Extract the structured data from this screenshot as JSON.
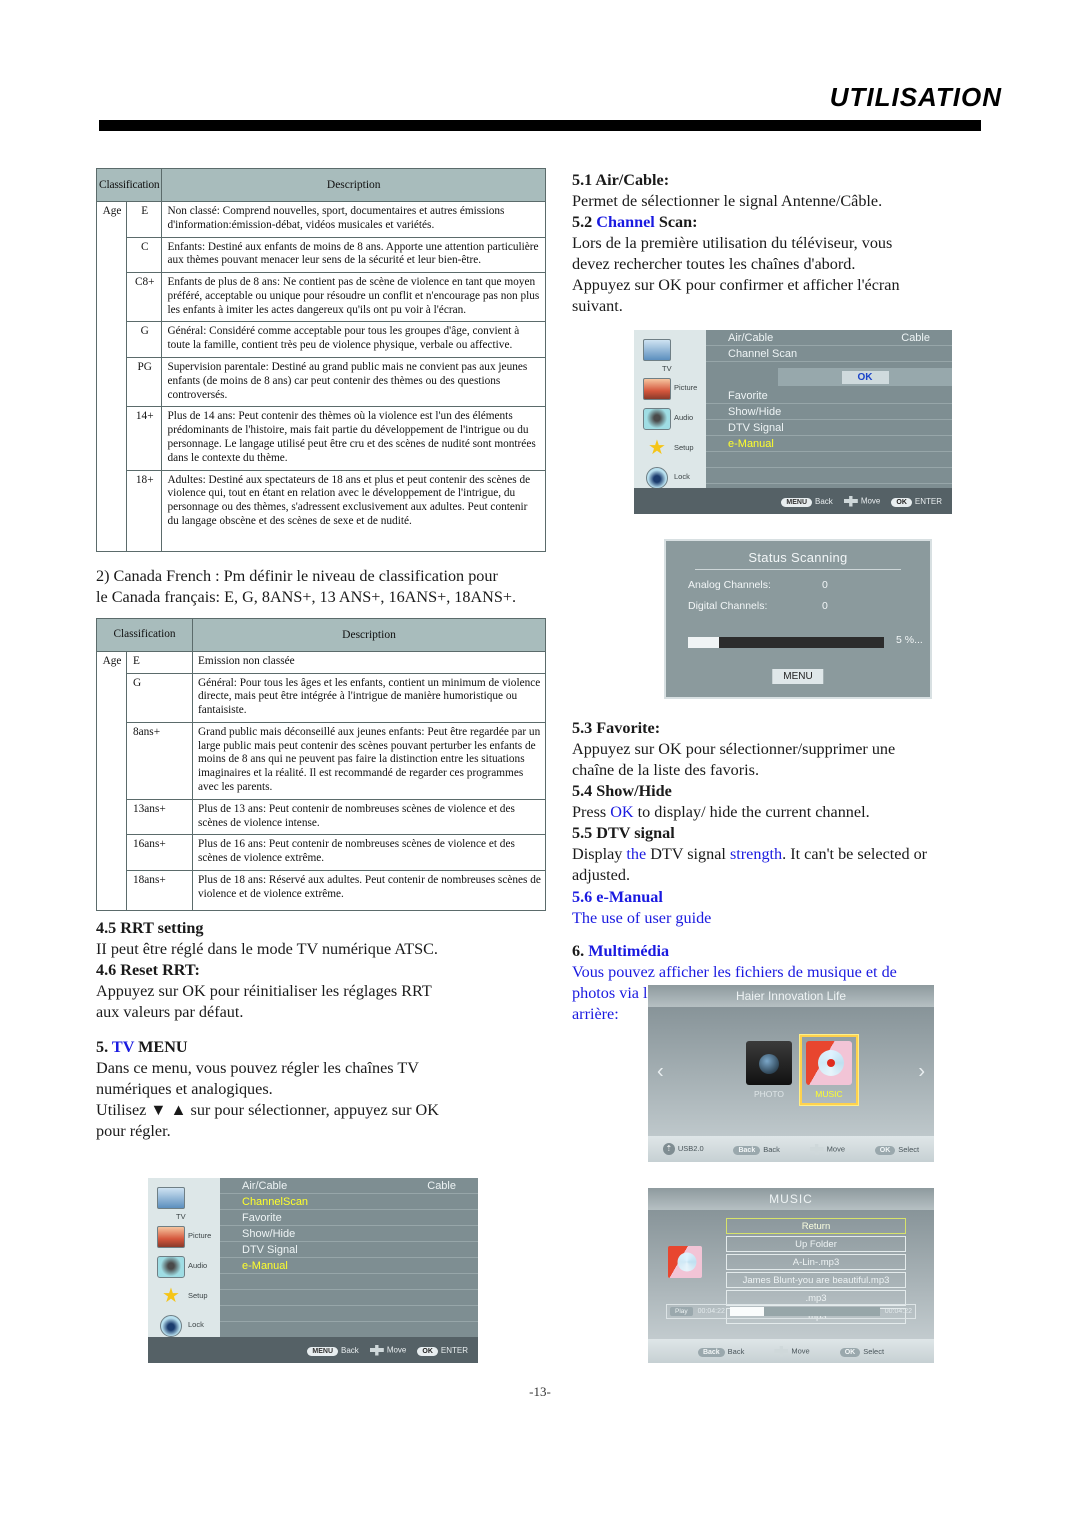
{
  "header": {
    "title": "UTILISATION"
  },
  "page_number": "-13-",
  "table1": {
    "col_classification": "Classification",
    "col_description": "Description",
    "age_label": "Age",
    "rows": [
      {
        "code": "E",
        "desc": "Non classé: Comprend nouvelles, sport, documentaires et autres émissions d'information:émission-débat, vidéos musicales et variétés."
      },
      {
        "code": "C",
        "desc": "Enfants: Destiné aux enfants de moins de 8 ans. Apporte une attention particulière aux thèmes pouvant menacer leur sens de la sécurité et leur bien-être."
      },
      {
        "code": "C8+",
        "desc": "Enfants de plus de 8 ans: Ne contient pas de scène de violence en tant que moyen préféré, acceptable ou unique pour résoudre un conflit et n'encourage pas non plus les enfants à imiter les actes dangereux qu'ils ont pu voir à l'écran."
      },
      {
        "code": "G",
        "desc": "Général: Considéré comme acceptable pour tous les groupes d'âge, convient à toute la famille, contient très peu de violence physique, verbale ou affective."
      },
      {
        "code": "PG",
        "desc": "Supervision parentale: Destiné au grand public mais ne convient pas aux jeunes enfants (de moins de 8 ans) car peut contenir des thèmes ou des questions controversés."
      },
      {
        "code": "14+",
        "desc": "Plus de 14 ans: Peut contenir des thèmes où la violence est l'un des éléments prédominants de l'histoire, mais fait partie du développement de l'intrigue ou du personnage. Le langage utilisé peut être cru et des scènes de nudité sont montrées dans le contexte du thème."
      },
      {
        "code": "18+",
        "desc": "Adultes: Destiné aux spectateurs de 18 ans et plus et peut contenir des scènes de violence qui, tout en étant en relation avec le développement de l'intrigue, du personnage ou des thèmes, s'adressent exclusivement aux adultes. Peut contenir du langage obscène et des scènes de sexe et de nudité."
      }
    ]
  },
  "mid_note": {
    "line1": "2) Canada French : Pm définir le niveau de classification pour",
    "line2": "le Canada français: E, G, 8ANS+, 13 ANS+, 16ANS+, 18ANS+."
  },
  "table2": {
    "col_classification": "Classification",
    "col_description": "Description",
    "age_label": "Age",
    "rows": [
      {
        "code": "E",
        "desc": "Emission non classée"
      },
      {
        "code": "G",
        "desc": "Général: Pour tous les âges et les enfants, contient un minimum de violence directe, mais peut être intégrée à l'intrigue de manière humoristique ou fantaisiste."
      },
      {
        "code": "8ans+",
        "desc": "Grand public mais déconseillé aux jeunes enfants: Peut être regardée par un large public mais peut contenir des scènes pouvant perturber les enfants de moins de 8 ans qui ne peuvent pas faire la distinction entre les situations imaginaires et la réalité. Il est recommandé de regarder ces programmes avec les parents."
      },
      {
        "code": "13ans+",
        "desc": "Plus de 13 ans: Peut contenir de nombreuses scènes de violence et des scènes de violence intense."
      },
      {
        "code": "16ans+",
        "desc": "Plus de 16 ans: Peut contenir de nombreuses scènes de violence et des scènes de violence extrême."
      },
      {
        "code": "18ans+",
        "desc": "Plus de 18 ans: Réservé aux adultes. Peut contenir de nombreuses scènes de violence et de violence extrême."
      }
    ]
  },
  "left_sections": {
    "s45_title": "4.5 RRT setting",
    "s45_body": "II peut être réglé dans le mode TV numérique ATSC.",
    "s46_title": "4.6 Reset RRT:",
    "s46_body_l1": "Appuyez sur OK pour réinitialiser les réglages RRT",
    "s46_body_l2": "aux valeurs par défaut.",
    "s5_num": "5.",
    "s5_blue": "TV",
    "s5_rest": "MENU",
    "s5_body_l1": "Dans ce menu, vous pouvez régler les chaînes TV",
    "s5_body_l2": "numériques et analogiques.",
    "s5_body_l3": "Utilisez ▼ ▲ sur pour sélectionner, appuyez sur OK",
    "s5_body_l4": "pour régler."
  },
  "right_sections": {
    "s51_title": "5.1 Air/Cable:",
    "s51_body": "Permet de sélectionner le signal Antenne/Câble.",
    "s52_num": "5.2",
    "s52_blue": "Channel",
    "s52_rest": "Scan:",
    "s52_body_l1": "Lors de la première utilisation du téléviseur, vous",
    "s52_body_l2": "devez rechercher toutes les chaînes d'abord.",
    "s52_body_l3": "Appuyez sur OK pour confirmer et afficher l'écran",
    "s52_body_l4": "suivant.",
    "s53_title": "5.3 Favorite:",
    "s53_body_l1": "Appuyez sur OK pour sélectionner/supprimer une",
    "s53_body_l2": "chaîne de la liste des favoris.",
    "s54_title": "5.4 Show/Hide",
    "s54_a": "Press ",
    "s54_blue": "OK",
    "s54_b": " to display/ hide the current channel.",
    "s55_title": "5.5 DTV signal",
    "s55_a": "Display ",
    "s55_blue1": "the",
    "s55_b": " DTV signal ",
    "s55_blue2": "strength",
    "s55_c": ". It can't be selected or",
    "s55_d": "adjusted.",
    "s56_title": "5.6 e-Manual",
    "s56_body": "The use of user guide",
    "s6_num": "6.",
    "s6_title": "Multimédia",
    "s6_body_l1": "Vous pouvez afficher les fichiers de musique et de",
    "s6_body_l2": "photos via le port USB qui se trouve sur le panneau",
    "s6_body_l3": "arrière:"
  },
  "osd_top": {
    "side_items": [
      {
        "label": "TV",
        "icon": "tv-icon"
      },
      {
        "label": "Picture",
        "icon": "picture-icon"
      },
      {
        "label": "Audio",
        "icon": "audio-icon"
      },
      {
        "label": "Setup",
        "icon": "setup-icon"
      },
      {
        "label": "Lock",
        "icon": "lock-icon"
      }
    ],
    "rows": [
      {
        "label": "Air/Cable",
        "value": "Cable"
      },
      {
        "label": "Channel Scan",
        "value": ""
      }
    ],
    "ok_label": "OK",
    "rows2": [
      {
        "label": "Favorite",
        "highlight": false
      },
      {
        "label": "Show/Hide",
        "highlight": false
      },
      {
        "label": "DTV Signal",
        "highlight": false
      },
      {
        "label": "e-Manual",
        "highlight": true
      }
    ],
    "footer": {
      "menu": "MENU",
      "back": "Back",
      "move": "Move",
      "ok": "OK",
      "enter": "ENTER"
    }
  },
  "osd_bottom": {
    "side_items": [
      {
        "label": "TV",
        "icon": "tv-icon"
      },
      {
        "label": "Picture",
        "icon": "picture-icon"
      },
      {
        "label": "Audio",
        "icon": "audio-icon"
      },
      {
        "label": "Setup",
        "icon": "setup-icon"
      },
      {
        "label": "Lock",
        "icon": "lock-icon"
      }
    ],
    "rows": [
      {
        "label": "Air/Cable",
        "value": "Cable",
        "highlight": false
      },
      {
        "label": "ChannelScan",
        "value": "",
        "highlight": true
      },
      {
        "label": "Favorite",
        "value": "",
        "highlight": false
      },
      {
        "label": "Show/Hide",
        "value": "",
        "highlight": false
      },
      {
        "label": "DTV Signal",
        "value": "",
        "highlight": false
      },
      {
        "label": "e-Manual",
        "value": "",
        "highlight": true
      }
    ],
    "footer": {
      "menu": "MENU",
      "back": "Back",
      "move": "Move",
      "ok": "OK",
      "enter": "ENTER"
    }
  },
  "scan_dialog": {
    "title": "Status Scanning",
    "analog_label": "Analog Channels:",
    "analog_value": "0",
    "digital_label": "Digital Channels:",
    "digital_value": "0",
    "percent": "5 %...",
    "menu_label": "MENU"
  },
  "multimedia": {
    "title": "Haier Innovation Life",
    "tiles": [
      {
        "label": "PHOTO",
        "selected": false
      },
      {
        "label": "MUSIC",
        "selected": true
      }
    ],
    "footer": {
      "usb": "USB2.0",
      "back": "Back",
      "move": "Move",
      "select": "Select",
      "ok": "OK"
    }
  },
  "music_screen": {
    "title": "MUSIC",
    "items": [
      {
        "label": "Return",
        "selected": true
      },
      {
        "label": "Up Folder",
        "selected": false
      },
      {
        "label": "A-Lin-.mp3",
        "selected": false
      },
      {
        "label": "James Blunt-you are beautiful.mp3",
        "selected": false
      },
      {
        "label": ".mp3",
        "selected": false
      },
      {
        "label": ".mp3",
        "selected": false
      }
    ],
    "player": {
      "play": "Play",
      "elapsed": "00:04:22",
      "total": "00:04:22"
    },
    "footer": {
      "back": "Back",
      "move": "Move",
      "select": "Select",
      "ok": "OK"
    }
  },
  "colors": {
    "accent_blue": "#1a1ae0",
    "table_header": "#a8bcbc",
    "osd_bg": "#7e8e92",
    "highlight_yellow": "#ffff2a"
  }
}
